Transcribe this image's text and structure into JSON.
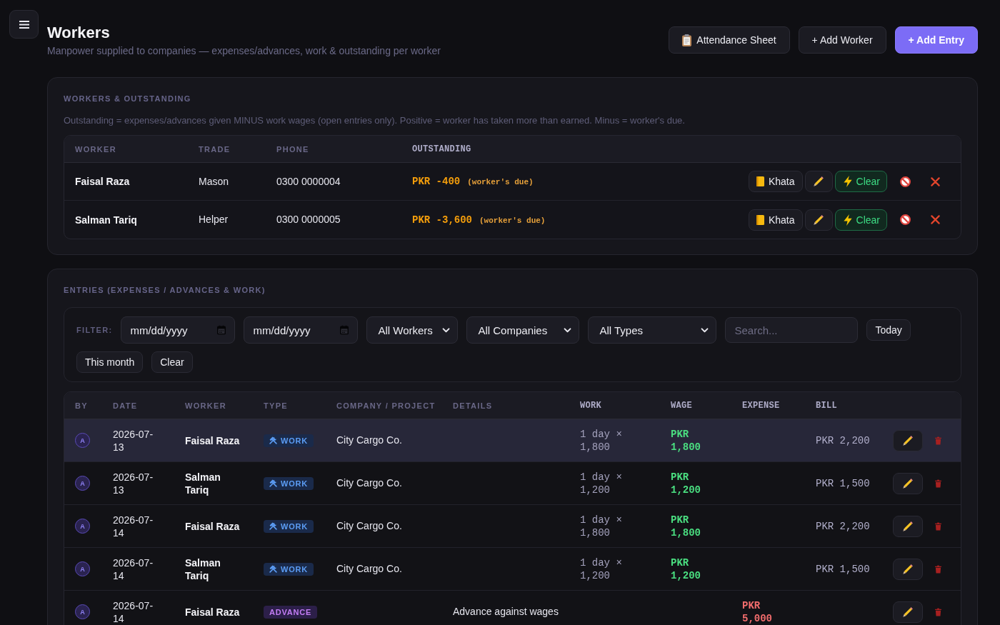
{
  "header": {
    "title": "Workers",
    "subtitle": "Manpower supplied to companies — expenses/advances, work & outstanding per worker",
    "actions": [
      {
        "label": "Attendance Sheet",
        "kind": "sheet"
      },
      {
        "label": "+ Add Worker",
        "kind": "secondary"
      },
      {
        "label": "+ Add Entry",
        "kind": "primary"
      }
    ]
  },
  "workers": {
    "heading": "WORKERS & OUTSTANDING",
    "note": "Outstanding = expenses/advances given MINUS work wages (open entries only). Positive = worker has taken more than earned. Minus = worker's due.",
    "columns": [
      {
        "label": "WORKER",
        "kind": "text"
      },
      {
        "label": "TRADE",
        "kind": "text"
      },
      {
        "label": "PHONE",
        "kind": "text"
      },
      {
        "label": "OUTSTANDING",
        "kind": "amount"
      }
    ],
    "rows": [
      {
        "name": "Faisal Raza",
        "trade": "Mason",
        "phone": "0300 0000004",
        "outstanding": "PKR -400",
        "outstanding_note": "(worker's due)",
        "khata_label": "Khata",
        "clear_label": "Clear"
      },
      {
        "name": "Salman Tariq",
        "trade": "Helper",
        "phone": "0300 0000005",
        "outstanding": "PKR -3,600",
        "outstanding_note": "(worker's due)",
        "khata_label": "Khata",
        "clear_label": "Clear"
      }
    ]
  },
  "entries": {
    "heading": "ENTRIES (EXPENSES / ADVANCES & WORK)",
    "filter": {
      "label": "FILTER:",
      "date_from": {
        "placeholder": "mm/dd/yyyy"
      },
      "date_to": {
        "placeholder": "mm/dd/yyyy"
      },
      "dropdowns": [
        {
          "value": "All Workers"
        },
        {
          "value": "All Companies"
        },
        {
          "value": "All Types"
        }
      ],
      "search": {
        "placeholder": "Search..."
      },
      "quick_buttons": [
        "Today",
        "This month",
        "Clear"
      ]
    },
    "table": {
      "columns": [
        {
          "label": "BY",
          "kind": "text"
        },
        {
          "label": "DATE",
          "kind": "text"
        },
        {
          "label": "WORKER",
          "kind": "text"
        },
        {
          "label": "TYPE",
          "kind": "text"
        },
        {
          "label": "COMPANY / PROJECT",
          "kind": "text"
        },
        {
          "label": "DETAILS",
          "kind": "text"
        },
        {
          "label": "WORK",
          "kind": "amount"
        },
        {
          "label": "WAGE",
          "kind": "amount"
        },
        {
          "label": "EXPENSE",
          "kind": "amount"
        },
        {
          "label": "BILL",
          "kind": "amount"
        }
      ],
      "rows": [
        {
          "by": "A",
          "date": "2026-07-13",
          "worker": "Faisal Raza",
          "type": {
            "label": "WORK",
            "kind": "work"
          },
          "company": "City Cargo Co.",
          "work": "1 day × 1,800",
          "wage": "PKR 1,800",
          "bill": "PKR 2,200",
          "highlighted": true
        },
        {
          "by": "A",
          "date": "2026-07-13",
          "worker": "Salman Tariq",
          "type": {
            "label": "WORK",
            "kind": "work"
          },
          "company": "City Cargo Co.",
          "work": "1 day × 1,200",
          "wage": "PKR 1,200",
          "bill": "PKR 1,500",
          "highlighted": false
        },
        {
          "by": "A",
          "date": "2026-07-14",
          "worker": "Faisal Raza",
          "type": {
            "label": "WORK",
            "kind": "work"
          },
          "company": "City Cargo Co.",
          "work": "1 day × 1,800",
          "wage": "PKR 1,800",
          "bill": "PKR 2,200",
          "highlighted": false
        },
        {
          "by": "A",
          "date": "2026-07-14",
          "worker": "Salman Tariq",
          "type": {
            "label": "WORK",
            "kind": "work"
          },
          "company": "City Cargo Co.",
          "work": "1 day × 1,200",
          "wage": "PKR 1,200",
          "bill": "PKR 1,500",
          "highlighted": false
        },
        {
          "by": "A",
          "date": "2026-07-14",
          "worker": "Faisal Raza",
          "type": {
            "label": "ADVANCE",
            "kind": "advance"
          },
          "details": "Advance against wages",
          "expense": "PKR 5,000",
          "highlighted": false
        }
      ]
    }
  }
}
